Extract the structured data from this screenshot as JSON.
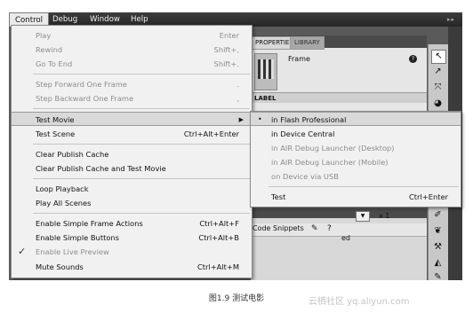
{
  "menubar": {
    "items": [
      "Control",
      "Debug",
      "Window",
      "Help"
    ],
    "right_glyph": "▸▸"
  },
  "control_menu": {
    "items": [
      {
        "label": "Play",
        "shortcut": "Enter",
        "disabled": true
      },
      {
        "label": "Rewind",
        "shortcut": "Shift+,",
        "disabled": true
      },
      {
        "label": "Go To End",
        "shortcut": "Shift+.",
        "disabled": true
      },
      {
        "label": "Step Forward One Frame",
        "shortcut": ".",
        "disabled": true
      },
      {
        "label": "Step Backward One Frame",
        "shortcut": ",",
        "disabled": true
      },
      {
        "label": "Test Movie",
        "shortcut": "",
        "disabled": false,
        "submenu": true,
        "highlighted": true
      },
      {
        "label": "Test Scene",
        "shortcut": "Ctrl+Alt+Enter",
        "disabled": false
      },
      {
        "label": "Clear Publish Cache",
        "shortcut": "",
        "disabled": false
      },
      {
        "label": "Clear Publish Cache and Test Movie",
        "shortcut": "",
        "disabled": false
      },
      {
        "label": "Loop Playback",
        "shortcut": "",
        "disabled": false
      },
      {
        "label": "Play All Scenes",
        "shortcut": "",
        "disabled": false
      },
      {
        "label": "Enable Simple Frame Actions",
        "shortcut": "Ctrl+Alt+F",
        "disabled": false
      },
      {
        "label": "Enable Simple Buttons",
        "shortcut": "Ctrl+Alt+B",
        "disabled": false
      },
      {
        "label": "Enable Live Preview",
        "shortcut": "",
        "disabled": false,
        "checked": true
      },
      {
        "label": "Mute Sounds",
        "shortcut": "Ctrl+Alt+M",
        "disabled": false
      }
    ],
    "check_glyph": "✓",
    "arrow_glyph": "▶"
  },
  "test_movie_submenu": {
    "items": [
      {
        "label": "in Flash Professional",
        "shortcut": "",
        "disabled": false,
        "selected": true,
        "highlighted": true
      },
      {
        "label": "in Device Central",
        "shortcut": "",
        "disabled": false
      },
      {
        "label": "in AIR Debug Launcher (Desktop)",
        "shortcut": "",
        "disabled": true
      },
      {
        "label": "in AIR Debug Launcher (Mobile)",
        "shortcut": "",
        "disabled": true
      },
      {
        "label": "on Device via USB",
        "shortcut": "",
        "disabled": true
      },
      {
        "label": "Test",
        "shortcut": "Ctrl+Enter",
        "disabled": false
      }
    ],
    "bullet_glyph": "•"
  },
  "properties_panel": {
    "tabs": [
      "PROPERTIES",
      "LIBRARY"
    ],
    "frame_label": "Frame",
    "help_glyph": "?",
    "section_label": "LABEL"
  },
  "lower_panel": {
    "dropdown_glyph": "▼",
    "zoom_text": "x 1",
    "snippets_label": "Code Snippets",
    "partial_text": "ed"
  },
  "caption": {
    "text": "图1.9    测试电影",
    "watermark": "云栖社区 yq.aliyun.com"
  },
  "colors": {
    "menubar": "#2f2f2f",
    "menu_bg": "#f1f1f1",
    "highlight": "#d9d9d9",
    "disabled_text": "#8d8d8d"
  }
}
